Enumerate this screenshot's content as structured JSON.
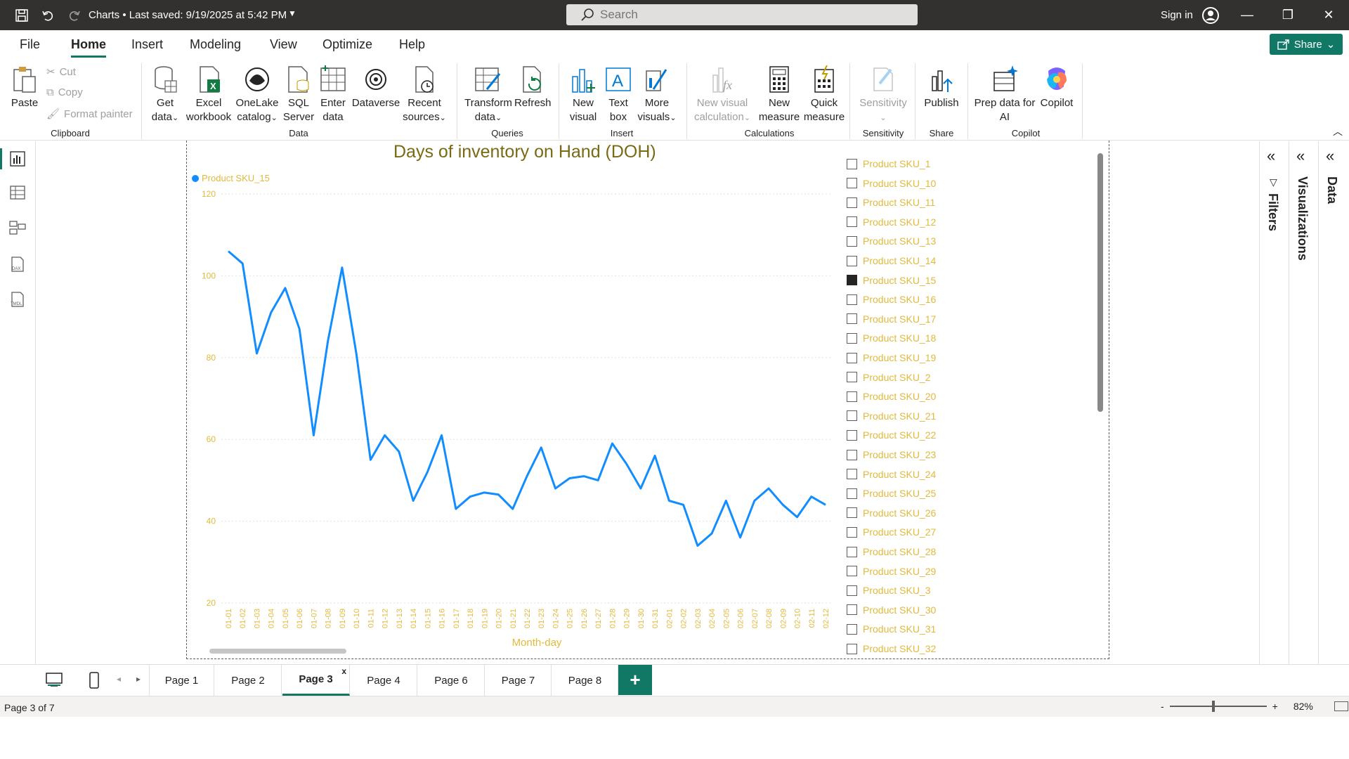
{
  "titlebar": {
    "title": "Charts • Last saved: 9/19/2025 at 5:42 PM",
    "search_placeholder": "Search",
    "signin": "Sign in"
  },
  "menu": {
    "tabs": [
      "File",
      "Home",
      "Insert",
      "Modeling",
      "View",
      "Optimize",
      "Help"
    ],
    "active": "Home",
    "share_label": "Share"
  },
  "ribbon": {
    "clipboard": {
      "paste": "Paste",
      "cut": "Cut",
      "copy": "Copy",
      "format_painter": "Format painter",
      "label": "Clipboard"
    },
    "data": {
      "get_data": [
        "Get",
        "data"
      ],
      "excel": [
        "Excel",
        "workbook"
      ],
      "onelake": [
        "OneLake",
        "catalog"
      ],
      "sql": [
        "SQL",
        "Server"
      ],
      "enter": [
        "Enter",
        "data"
      ],
      "dataverse": [
        "Dataverse"
      ],
      "recent": [
        "Recent",
        "sources"
      ],
      "label": "Data"
    },
    "queries": {
      "transform": [
        "Transform",
        "data"
      ],
      "refresh": [
        "Refresh"
      ],
      "label": "Queries"
    },
    "insert": {
      "new_visual": [
        "New",
        "visual"
      ],
      "text_box": [
        "Text",
        "box"
      ],
      "more_visuals": [
        "More",
        "visuals"
      ],
      "label": "Insert"
    },
    "calculations": {
      "new_visual_calc": [
        "New visual",
        "calculation"
      ],
      "new_measure": [
        "New",
        "measure"
      ],
      "quick_measure": [
        "Quick",
        "measure"
      ],
      "label": "Calculations"
    },
    "sensitivity": {
      "button": [
        "Sensitivity"
      ],
      "label": "Sensitivity"
    },
    "share": {
      "publish": [
        "Publish"
      ],
      "label": "Share"
    },
    "copilot": {
      "prep": [
        "Prep data for",
        "AI"
      ],
      "copilot": [
        "Copilot"
      ],
      "label": "Copilot"
    }
  },
  "chart_data": {
    "type": "line",
    "title": "Days of inventory on Hand (DOH)",
    "xlabel": "Month-day",
    "ylabel": "",
    "ylim": [
      20,
      120
    ],
    "yticks": [
      20,
      40,
      60,
      80,
      100,
      120
    ],
    "grid": true,
    "legend": "top-left",
    "series_color": "#118dff",
    "label_color": "#e2b93b",
    "categories": [
      "01-01",
      "01-02",
      "01-03",
      "01-04",
      "01-05",
      "01-06",
      "01-07",
      "01-08",
      "01-09",
      "01-10",
      "01-11",
      "01-12",
      "01-13",
      "01-14",
      "01-15",
      "01-16",
      "01-17",
      "01-18",
      "01-19",
      "01-20",
      "01-21",
      "01-22",
      "01-23",
      "01-24",
      "01-25",
      "01-26",
      "01-27",
      "01-28",
      "01-29",
      "01-30",
      "01-31",
      "02-01",
      "02-02",
      "02-03",
      "02-04",
      "02-05",
      "02-06",
      "02-07",
      "02-08",
      "02-09",
      "02-10",
      "02-11",
      "02-12"
    ],
    "series": [
      {
        "name": "Product SKU_15",
        "values": [
          106,
          103,
          81,
          91,
          97,
          87,
          61,
          84,
          102,
          81,
          55,
          61,
          57,
          45,
          52,
          61,
          43,
          46,
          47,
          46.5,
          43,
          51,
          58,
          48,
          50.5,
          51,
          50,
          59,
          54,
          48,
          56,
          45,
          44,
          34,
          37,
          45,
          36,
          45,
          48,
          44,
          41,
          46,
          44
        ]
      }
    ]
  },
  "slicer": {
    "items": [
      "Product SKU_1",
      "Product SKU_10",
      "Product SKU_11",
      "Product SKU_12",
      "Product SKU_13",
      "Product SKU_14",
      "Product SKU_15",
      "Product SKU_16",
      "Product SKU_17",
      "Product SKU_18",
      "Product SKU_19",
      "Product SKU_2",
      "Product SKU_20",
      "Product SKU_21",
      "Product SKU_22",
      "Product SKU_23",
      "Product SKU_24",
      "Product SKU_25",
      "Product SKU_26",
      "Product SKU_27",
      "Product SKU_28",
      "Product SKU_29",
      "Product SKU_3",
      "Product SKU_30",
      "Product SKU_31",
      "Product SKU_32"
    ],
    "selected": "Product SKU_15"
  },
  "panes": {
    "filters": "Filters",
    "visualizations": "Visualizations",
    "data": "Data"
  },
  "pages": {
    "tabs": [
      "Page 1",
      "Page 2",
      "Page 3",
      "Page 4",
      "Page 6",
      "Page 7",
      "Page 8"
    ],
    "active": "Page 3"
  },
  "status": {
    "page_info": "Page 3 of 7",
    "zoom": "82%"
  },
  "colors": {
    "accent": "#117865",
    "titlebar": "#323130"
  }
}
